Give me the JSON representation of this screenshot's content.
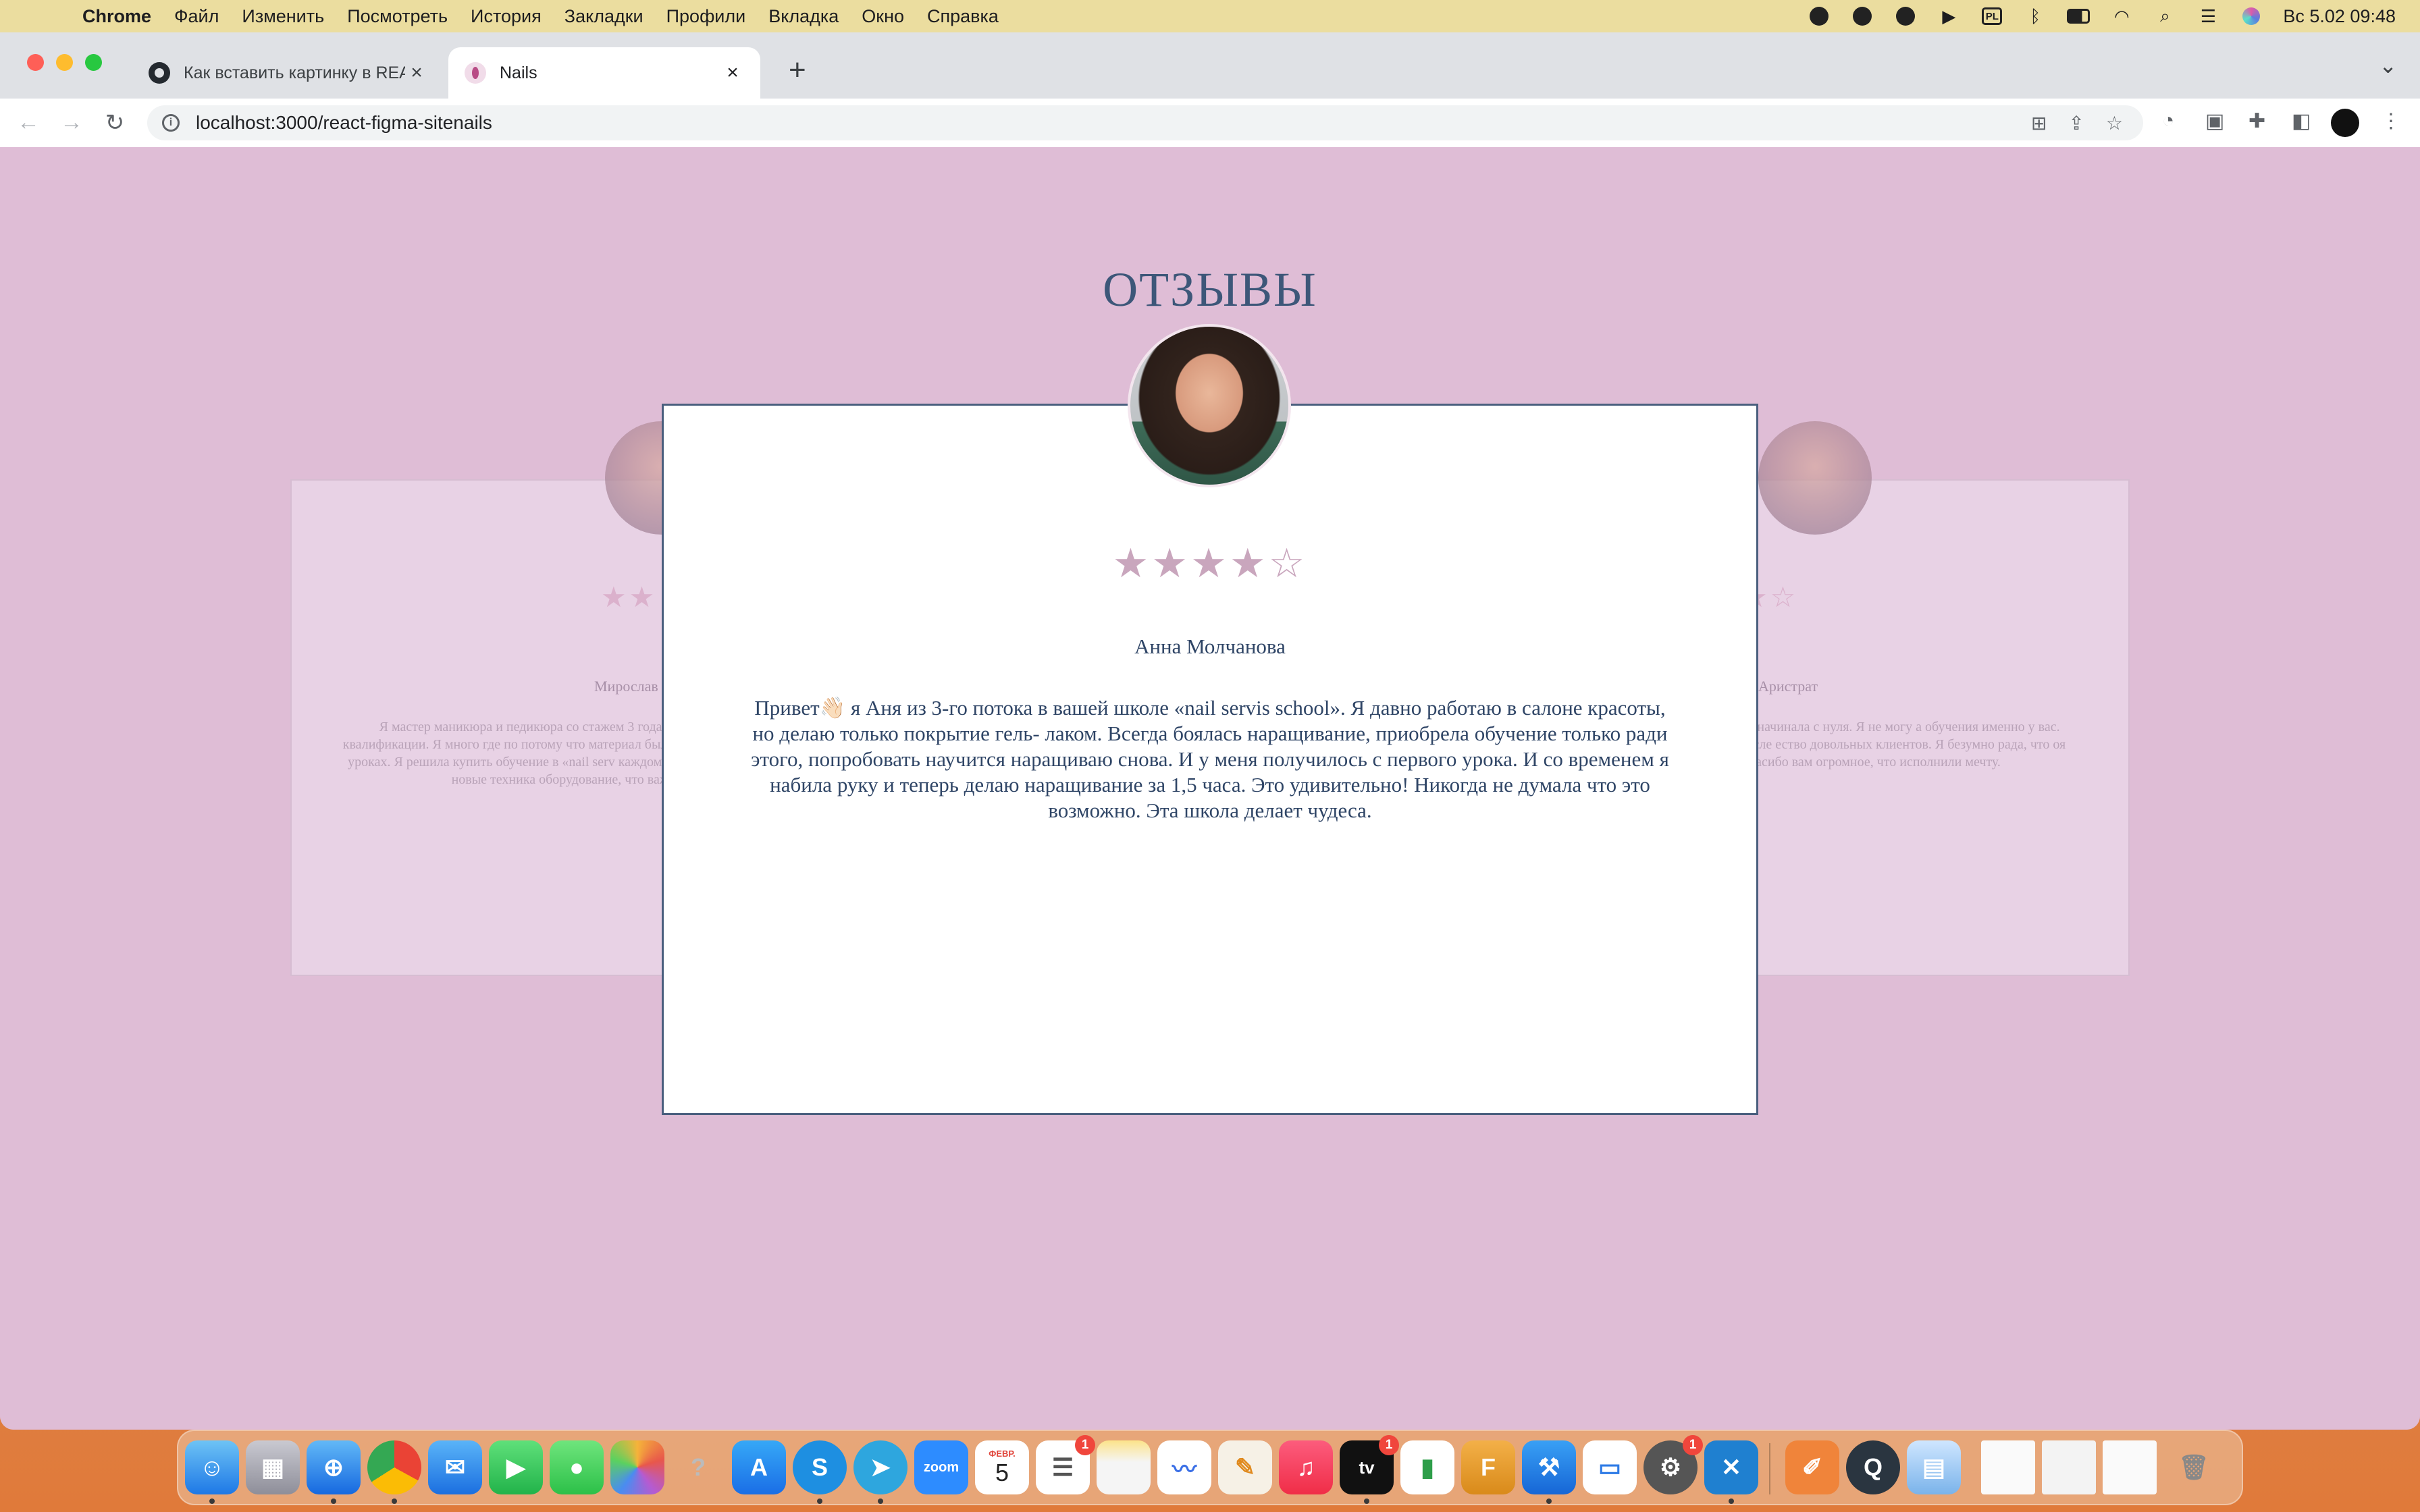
{
  "menubar": {
    "app": "Chrome",
    "items": [
      "Файл",
      "Изменить",
      "Посмотреть",
      "История",
      "Закладки",
      "Профили",
      "Вкладка",
      "Окно",
      "Справка"
    ],
    "keyboard": "PL",
    "datetime": "Вс 5.02  09:48"
  },
  "browser": {
    "tabs": [
      {
        "title": "Как вставить картинку в README"
      },
      {
        "title": "Nails"
      }
    ],
    "url": "localhost:3000/react-figma-sitenails"
  },
  "page": {
    "section_title": "ОТЗЫВЫ",
    "left_card": {
      "stars": "★★",
      "name": "Мирослав",
      "text": "Я мастер маникюра и педикюра со стажем 3 года для повышения квалификации. Я много где по потому что материал был абсолютно банальны уроках. Я решила купить обучение в «nail serv каждому ученику, абсолютно новые техника оборудование, что важно"
    },
    "right_card": {
      "stars": "★☆",
      "name": "Аристрат",
      "text": "\"nails servis school\", начинала с нуля. Я не могу а обучения именно у вас. Прошло 2 месяца после ество довольных клиентов. Я безумно рада, что оя мечта. Спасибо вам огромное, что исполнили мечту."
    },
    "modal": {
      "stars": "★★★★☆",
      "rating": 4,
      "name": "Анна Молчанова",
      "text": "Привет👋🏻 я Аня из 3-го потока в вашей школе «nail servis school». Я давно работаю в салоне красоты, но делаю только покрытие гель- лаком. Всегда боялась наращивание, приобрела обучение только ради этого, попробовать научится наращиваю снова. И у меня получилось с первого урока. И со временем я набила руку и теперь делаю наращивание за 1,5 часа. Это удивительно! Никогда не думала что это возможно. Эта школа делает чудеса."
    }
  },
  "dock": {
    "calendar_month": "ФЕВР.",
    "calendar_day": "5",
    "zoom_label": "zoom",
    "tv_label": "tv",
    "badge": "1"
  }
}
